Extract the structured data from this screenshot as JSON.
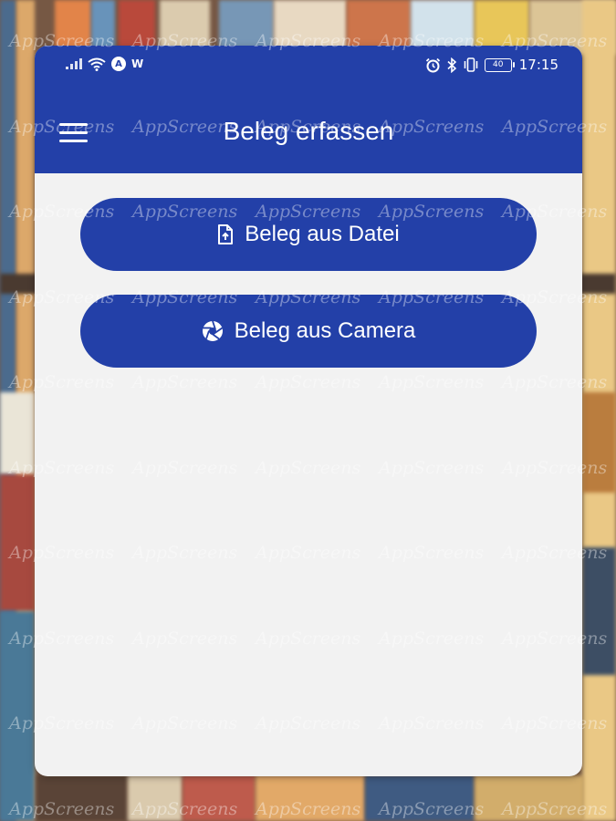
{
  "status_bar": {
    "left_icons": [
      "signal-icon",
      "wifi-icon",
      "a-circle-icon"
    ],
    "a_glyph": "A",
    "w_glyph": "W",
    "right_icons": [
      "alarm-icon",
      "bluetooth-icon",
      "vibrate-icon",
      "battery-icon"
    ],
    "battery_level": "40",
    "time": "17:15"
  },
  "app_bar": {
    "title": "Beleg erfassen",
    "menu_icon": "hamburger-menu-icon",
    "color": "#2340a8"
  },
  "actions": {
    "from_file": {
      "label": "Beleg aus Datei",
      "icon": "file-upload-icon"
    },
    "from_camera": {
      "label": "Beleg aus Camera",
      "icon": "camera-shutter-icon"
    }
  },
  "watermark": {
    "text": "AppScreens"
  },
  "colors": {
    "primary": "#2340a8",
    "surface": "#f2f2f2",
    "on_primary": "#ffffff"
  }
}
